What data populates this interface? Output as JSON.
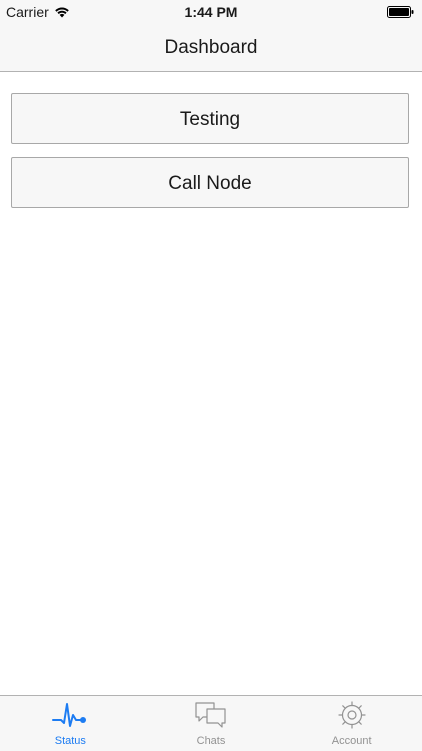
{
  "status_bar": {
    "carrier": "Carrier",
    "time": "1:44 PM",
    "icons": [
      "wifi-icon",
      "battery-icon"
    ]
  },
  "nav": {
    "title": "Dashboard"
  },
  "buttons": {
    "testing_label": "Testing",
    "call_node_label": "Call Node"
  },
  "tab_bar": {
    "active_color": "#1d7cf2",
    "inactive_color": "#929292",
    "tabs": [
      {
        "label": "Status",
        "icon": "pulse-icon",
        "active": true
      },
      {
        "label": "Chats",
        "icon": "chat-bubbles-icon",
        "active": false
      },
      {
        "label": "Account",
        "icon": "gear-icon",
        "active": false
      }
    ]
  }
}
